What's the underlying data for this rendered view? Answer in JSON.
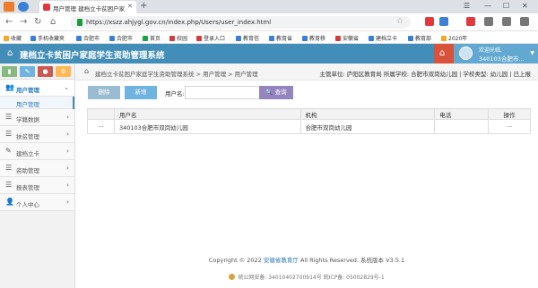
{
  "browser": {
    "tab_title": "用户管理 建档立卡贫困户家庭学",
    "new_tab": "+",
    "url": "https://xszz.ahjygl.gov.cn/index.php/Users/user_index.html",
    "bookmarks": [
      {
        "label": "收藏",
        "color": "#f5a623"
      },
      {
        "label": "手机收藏夹",
        "color": "#3d7fd6"
      },
      {
        "label": "合肥市",
        "color": "#3d7fd6"
      },
      {
        "label": "合肥市",
        "color": "#3d7fd6"
      },
      {
        "label": "首页",
        "color": "#1aa34a"
      },
      {
        "label": "校园",
        "color": "#d23c3c"
      },
      {
        "label": "登录入口",
        "color": "#d23c3c"
      },
      {
        "label": "教育信",
        "color": "#3d7fd6"
      },
      {
        "label": "教育省",
        "color": "#3d7fd6"
      },
      {
        "label": "教育移",
        "color": "#3d7fd6"
      },
      {
        "label": "安徽省",
        "color": "#d23c3c"
      },
      {
        "label": "建档立卡",
        "color": "#3d7fd6"
      },
      {
        "label": "教育部",
        "color": "#3d7fd6"
      },
      {
        "label": "2020年",
        "color": "#f5a623"
      }
    ]
  },
  "header": {
    "title": "建档立卡贫困户家庭学生资助管理系统",
    "welcome": "欢迎光临,",
    "username": "340103合肥市..."
  },
  "sidebar": {
    "items": [
      {
        "label": "用户管理",
        "icon": "users-icon",
        "glyph": "👥",
        "open": true
      },
      {
        "label": "学籍数据",
        "icon": "list-icon",
        "glyph": "☰",
        "open": false
      },
      {
        "label": "扶贫管理",
        "icon": "list-icon",
        "glyph": "☰",
        "open": false
      },
      {
        "label": "建档立卡",
        "icon": "edit-icon",
        "glyph": "✎",
        "open": false
      },
      {
        "label": "资助管理",
        "icon": "list-icon",
        "glyph": "☰",
        "open": false
      },
      {
        "label": "报表管理",
        "icon": "list-icon",
        "glyph": "☰",
        "open": false
      },
      {
        "label": "个人中心",
        "icon": "user-icon",
        "glyph": "👤",
        "open": false
      }
    ],
    "submenu_label": "用户管理"
  },
  "breadcrumb": {
    "crumbs": "建档立卡贫困户家庭学生资助管理系统 > 用户管理 > 用户管理",
    "info": "主管单位: 庐阳区教育局   所属学校: 合肥市双岗幼儿园 | 学校类型: 幼儿园 | 已上报"
  },
  "toolbar": {
    "delete_label": "删除",
    "add_label": "新增",
    "username_label": "用户名:",
    "username_value": "",
    "search_label": "查询"
  },
  "table": {
    "headers": [
      "",
      "用户名",
      "机构",
      "电话",
      "操作"
    ],
    "rows": [
      [
        "···",
        "340103合肥市双岗幼儿园",
        "合肥市双岗幼儿园",
        "",
        "···"
      ]
    ]
  },
  "footer": {
    "copyright_prefix": "Copyright © 2022 ",
    "org_link": "安徽省教育厅",
    "copyright_suffix": " All Rights Reserved.  系统版本 V3.5.1",
    "record": "皖公网安备: 34010402700914号   皖ICP备: 05002829号-1"
  }
}
